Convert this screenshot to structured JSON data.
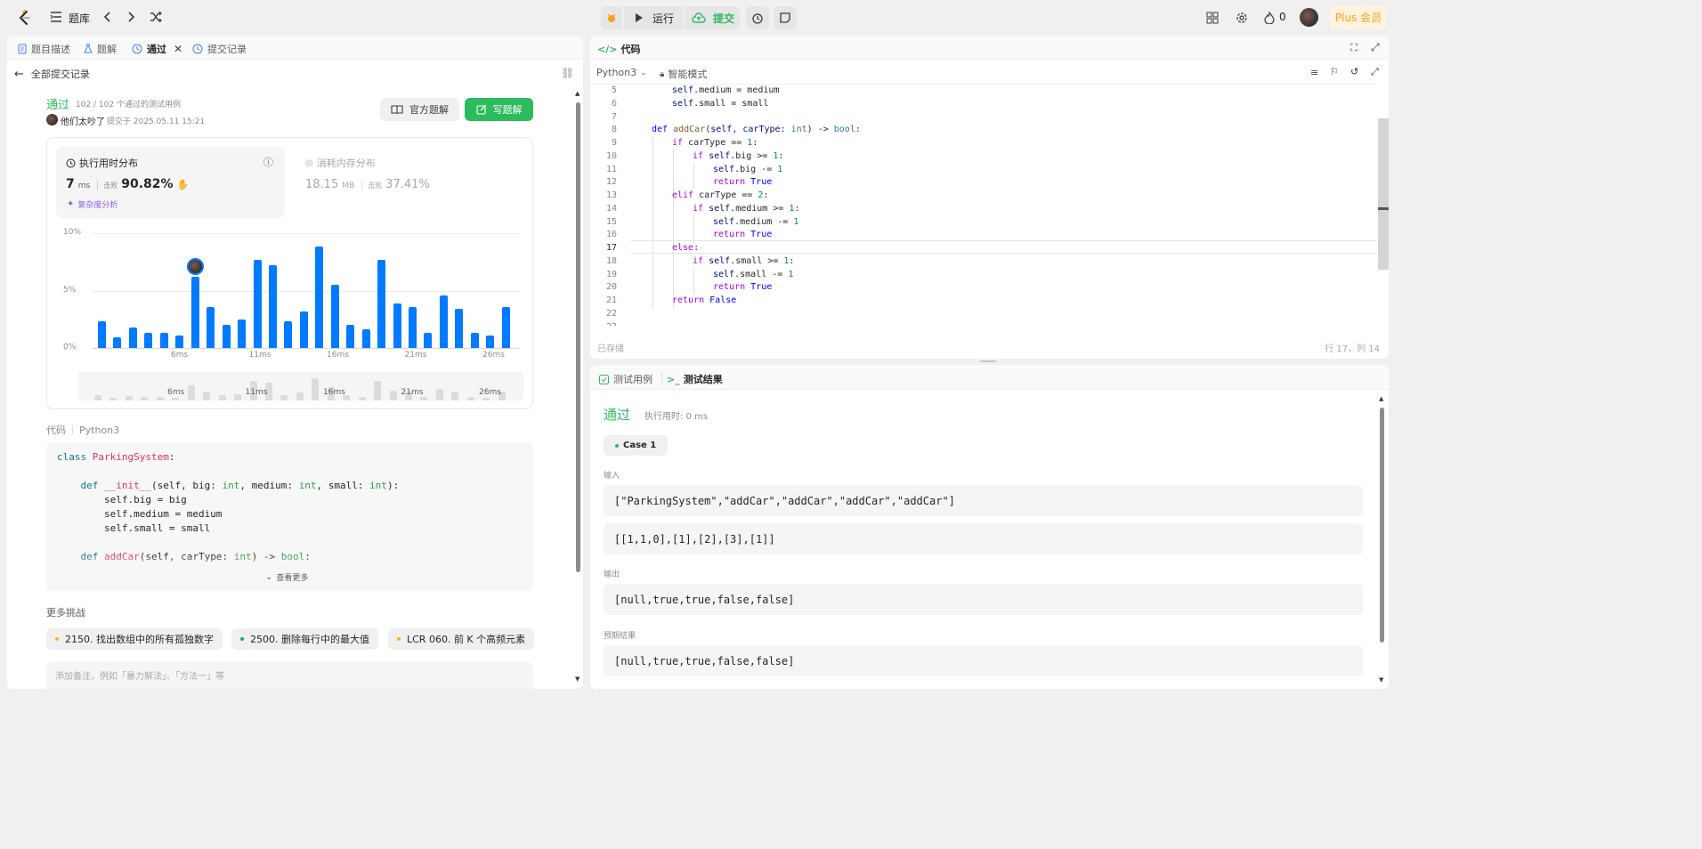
{
  "topbar": {
    "problem_bank": "题库",
    "run": "运行",
    "submit": "提交",
    "streak": "0",
    "plus": "Plus 会员"
  },
  "left_tabs": [
    {
      "label": "题目描述"
    },
    {
      "label": "题解"
    },
    {
      "label": "通过"
    },
    {
      "label": "提交记录"
    }
  ],
  "back_label": "全部提交记录",
  "result": {
    "status": "通过",
    "testcases": "102 / 102 个通过的测试用例",
    "user": "他们太吵了",
    "submitted_at": "提交于 2025.05.11 15:21",
    "official_btn": "官方题解",
    "write_btn": "写题解"
  },
  "runtime": {
    "title": "执行用时分布",
    "value": "7",
    "unit": "ms",
    "beats_label": "击败",
    "beats": "90.82%",
    "complexity": "复杂度分析"
  },
  "memory": {
    "title": "消耗内存分布",
    "value": "18.15",
    "unit": "MB",
    "beats_label": "击败",
    "beats": "37.41%"
  },
  "chart_data": {
    "type": "bar",
    "title": "执行用时分布",
    "ylim": [
      0,
      10
    ],
    "yticks": [
      "10%",
      "5%",
      "0%"
    ],
    "xticks": [
      "6ms",
      "11ms",
      "16ms",
      "21ms",
      "26ms"
    ],
    "values": [
      2.3,
      0.9,
      1.8,
      1.3,
      1.3,
      1.1,
      6.2,
      3.6,
      2.0,
      2.5,
      7.7,
      7.2,
      2.3,
      3.2,
      8.8,
      5.5,
      2.0,
      1.6,
      7.7,
      3.9,
      3.6,
      1.3,
      4.6,
      3.4,
      1.3,
      1.1,
      3.6
    ],
    "highlight_index": 6
  },
  "code_section": {
    "label": "代码",
    "lang": "Python3",
    "more": "查看更多"
  },
  "more_challenges": {
    "title": "更多挑战",
    "items": [
      {
        "label": "2150. 找出数组中的所有孤独数字",
        "color": "#ffb800"
      },
      {
        "label": "2500. 删除每行中的最大值",
        "color": "#00af9b"
      },
      {
        "label": "LCR 060. 前 K 个高频元素",
        "color": "#ffb800"
      }
    ]
  },
  "note_placeholder": "添加备注，例如「暴力解法」、「方法一」等",
  "editor": {
    "title": "代码",
    "lang": "Python3",
    "mode": "智能模式",
    "saved": "已存储",
    "cursor": "行 17，列 14"
  },
  "tests": {
    "tab_cases": "测试用例",
    "tab_result": "测试结果",
    "status": "通过",
    "runtime": "执行用时: 0 ms",
    "case": "Case 1",
    "input_label": "输入",
    "input1": "[\"ParkingSystem\",\"addCar\",\"addCar\",\"addCar\",\"addCar\"]",
    "input2": "[[1,1,0],[1],[2],[3],[1]]",
    "output_label": "输出",
    "output": "[null,true,true,false,false]",
    "expected_label": "预期结果",
    "expected": "[null,true,true,false,false]"
  }
}
